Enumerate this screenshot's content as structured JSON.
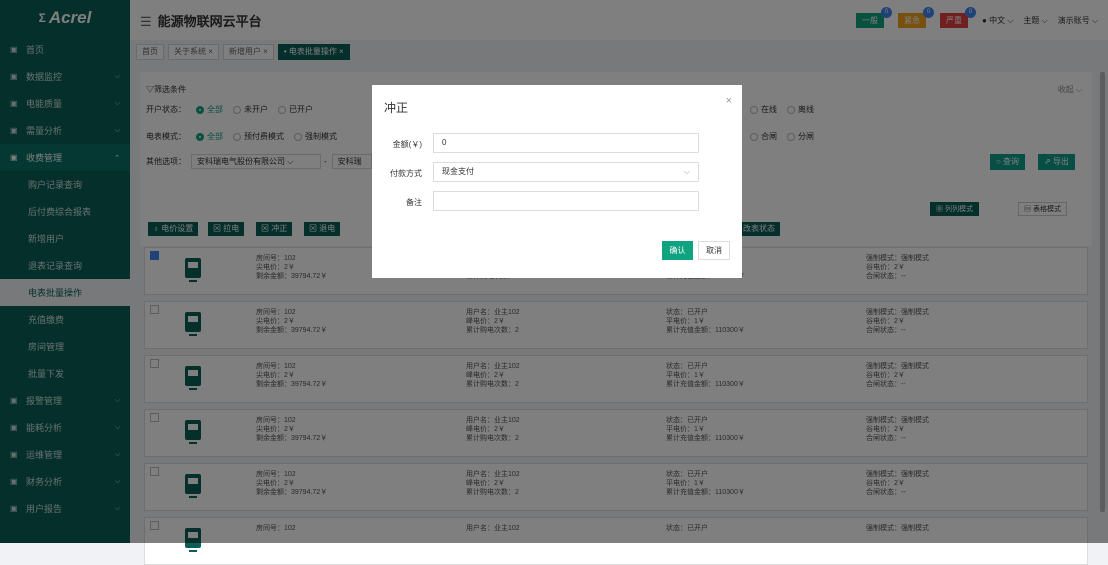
{
  "logo": {
    "mark": "Σ",
    "text": "Acrel"
  },
  "sidebar": {
    "items": [
      {
        "label": "首页",
        "icon": "home-icon",
        "sub": false
      },
      {
        "label": "数据监控",
        "icon": "monitor-icon",
        "sub": false,
        "chev": "⌵"
      },
      {
        "label": "电能质量",
        "icon": "power-icon",
        "sub": false,
        "chev": "⌵"
      },
      {
        "label": "需量分析",
        "icon": "chart-icon",
        "sub": false,
        "chev": "⌵"
      },
      {
        "label": "收费管理",
        "icon": "user-icon",
        "sub": false,
        "chev": "⌃",
        "active": true
      },
      {
        "label": "购户记录查询",
        "sub": true
      },
      {
        "label": "后付费综合报表",
        "sub": true
      },
      {
        "label": "新增用户",
        "sub": true
      },
      {
        "label": "退表记录查询",
        "sub": true
      },
      {
        "label": "电表批量操作",
        "sub": true,
        "current": true
      },
      {
        "label": "充值缴费",
        "sub": true
      },
      {
        "label": "房间管理",
        "sub": true
      },
      {
        "label": "批量下发",
        "sub": true
      },
      {
        "label": "报警管理",
        "icon": "alarm-icon",
        "sub": false,
        "chev": "⌵"
      },
      {
        "label": "能耗分析",
        "icon": "energy-icon",
        "sub": false,
        "chev": "⌵"
      },
      {
        "label": "运维管理",
        "icon": "tools-icon",
        "sub": false,
        "chev": "⌵"
      },
      {
        "label": "财务分析",
        "icon": "finance-icon",
        "sub": false,
        "chev": "⌵"
      },
      {
        "label": "用户报告",
        "icon": "report-icon",
        "sub": false,
        "chev": "⌵"
      }
    ]
  },
  "header": {
    "menu_glyph": "☰",
    "title": "能源物联网云平台",
    "badges": [
      {
        "label": "一般",
        "count": "0",
        "color": "#10a37f"
      },
      {
        "label": "紧急",
        "count": "0",
        "color": "#f0a020"
      },
      {
        "label": "严重",
        "count": "0",
        "color": "#e04040"
      }
    ],
    "lang": "中文",
    "theme": "主题",
    "account": "演示账号"
  },
  "tabs": [
    {
      "label": "首页"
    },
    {
      "label": "关于系统 ×"
    },
    {
      "label": "新增用户 ×"
    },
    {
      "label": "• 电表批量操作 ×",
      "active": true
    }
  ],
  "filter": {
    "title": "▽筛选条件",
    "collapse": "收起 ⌵",
    "open_label": "开户状态：",
    "open_opts": [
      "全部",
      "未开户",
      "已开户"
    ],
    "online_opts": [
      "在线",
      "离线"
    ],
    "mode_label": "电表模式：",
    "mode_opts": [
      "全部",
      "预付费模式",
      "强制模式"
    ],
    "switch_opts": [
      "合闸",
      "分闸"
    ],
    "other_label": "其他选项：",
    "company": "安科瑞电气股份有限公司",
    "company2": "安科瑞",
    "query": "○ 查询",
    "export": "⇗ 导出"
  },
  "toolbar": {
    "buttons": [
      "♁ 电价设置",
      "⊠ 拉电",
      "⊠ 冲正",
      "⊠ 退电"
    ],
    "extra": "改表状态",
    "mode_list": "▦ 列列模式",
    "mode_table": "▤ 表格模式"
  },
  "cards": [
    {
      "room": "房间号：102",
      "peak": "尖电价：2￥",
      "balance": "剩余金额：39794.72￥",
      "user": "用户名：业主102",
      "valley": "峰电价：2￥",
      "count": "累计购电次数：2",
      "state": "状态：已开户",
      "flat": "平电价：1￥",
      "total": "累计充值金额：110300￥",
      "force": "强制模式：强制模式",
      "valley2": "谷电价：2￥",
      "switch": "合闸状态：--",
      "checked": true
    },
    {
      "room": "房间号：102",
      "peak": "尖电价：2￥",
      "balance": "剩余金额：39794.72￥",
      "user": "用户名：业主102",
      "valley": "峰电价：2￥",
      "count": "累计购电次数：2",
      "state": "状态：已开户",
      "flat": "平电价：1￥",
      "total": "累计充值金额：110300￥",
      "force": "强制模式：强制模式",
      "valley2": "谷电价：2￥",
      "switch": "合闸状态：--",
      "checked": false
    },
    {
      "room": "房间号：102",
      "peak": "尖电价：2￥",
      "balance": "剩余金额：39794.72￥",
      "user": "用户名：业主102",
      "valley": "峰电价：2￥",
      "count": "累计购电次数：2",
      "state": "状态：已开户",
      "flat": "平电价：1￥",
      "total": "累计充值金额：110300￥",
      "force": "强制模式：强制模式",
      "valley2": "谷电价：2￥",
      "switch": "合闸状态：--",
      "checked": false
    },
    {
      "room": "房间号：102",
      "peak": "尖电价：2￥",
      "balance": "剩余金额：39794.72￥",
      "user": "用户名：业主102",
      "valley": "峰电价：2￥",
      "count": "累计购电次数：2",
      "state": "状态：已开户",
      "flat": "平电价：1￥",
      "total": "累计充值金额：110300￥",
      "force": "强制模式：强制模式",
      "valley2": "谷电价：2￥",
      "switch": "合闸状态：--",
      "checked": false
    },
    {
      "room": "房间号：102",
      "peak": "尖电价：2￥",
      "balance": "剩余金额：39794.72￥",
      "user": "用户名：业主102",
      "valley": "峰电价：2￥",
      "count": "累计购电次数：2",
      "state": "状态：已开户",
      "flat": "平电价：1￥",
      "total": "累计充值金额：110300￥",
      "force": "强制模式：强制模式",
      "valley2": "谷电价：2￥",
      "switch": "合闸状态：--",
      "checked": false
    },
    {
      "room": "房间号：102",
      "peak": "",
      "balance": "",
      "user": "用户名：业主102",
      "valley": "",
      "count": "",
      "state": "状态：已开户",
      "flat": "",
      "total": "",
      "force": "强制模式：强制模式",
      "valley2": "",
      "switch": "",
      "checked": false
    }
  ],
  "modal": {
    "title": "冲正",
    "close": "×",
    "amount_label": "金额(￥)",
    "amount_value": "0",
    "pay_label": "付款方式",
    "pay_value": "现金支付",
    "pay_chevron": "⌵",
    "note_label": "备注",
    "note_value": "",
    "confirm": "确认",
    "cancel": "取消"
  }
}
